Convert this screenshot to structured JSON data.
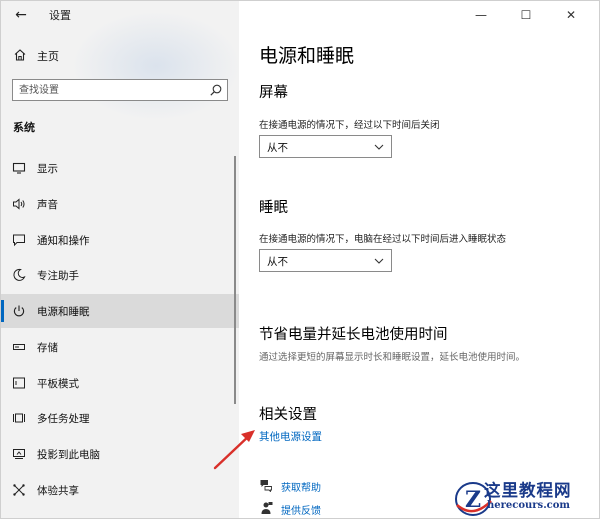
{
  "app": {
    "title": "设置"
  },
  "titlebar": {
    "back": "←",
    "minimize": "—",
    "maximize": "☐",
    "close": "✕"
  },
  "sidebar": {
    "home_label": "主页",
    "search_placeholder": "查找设置",
    "section_title": "系统",
    "items": [
      {
        "label": "显示",
        "icon": "display-icon"
      },
      {
        "label": "声音",
        "icon": "sound-icon"
      },
      {
        "label": "通知和操作",
        "icon": "notification-icon"
      },
      {
        "label": "专注助手",
        "icon": "moon-icon"
      },
      {
        "label": "电源和睡眠",
        "icon": "power-icon",
        "selected": true
      },
      {
        "label": "存储",
        "icon": "storage-icon"
      },
      {
        "label": "平板模式",
        "icon": "tablet-icon"
      },
      {
        "label": "多任务处理",
        "icon": "multitask-icon"
      },
      {
        "label": "投影到此电脑",
        "icon": "project-icon"
      },
      {
        "label": "体验共享",
        "icon": "share-icon"
      }
    ]
  },
  "main": {
    "title": "电源和睡眠",
    "screen": {
      "heading": "屏幕",
      "desc": "在接通电源的情况下，经过以下时间后关闭",
      "value": "从不"
    },
    "sleep": {
      "heading": "睡眠",
      "desc": "在接通电源的情况下，电脑在经过以下时间后进入睡眠状态",
      "value": "从不"
    },
    "battery": {
      "heading": "节省电量并延长电池使用时间",
      "desc": "通过选择更短的屏幕显示时长和睡眠设置，延长电池使用时间。"
    },
    "related": {
      "heading": "相关设置",
      "link": "其他电源设置"
    },
    "help": {
      "get_help": "获取帮助",
      "feedback": "提供反馈"
    }
  },
  "watermark": {
    "line1": "这里教程网",
    "line2": "herecours.com",
    "logo_letter": "Z"
  },
  "colors": {
    "accent": "#0067c0",
    "annotation": "#d9302a",
    "watermark": "#1a3a8a"
  }
}
